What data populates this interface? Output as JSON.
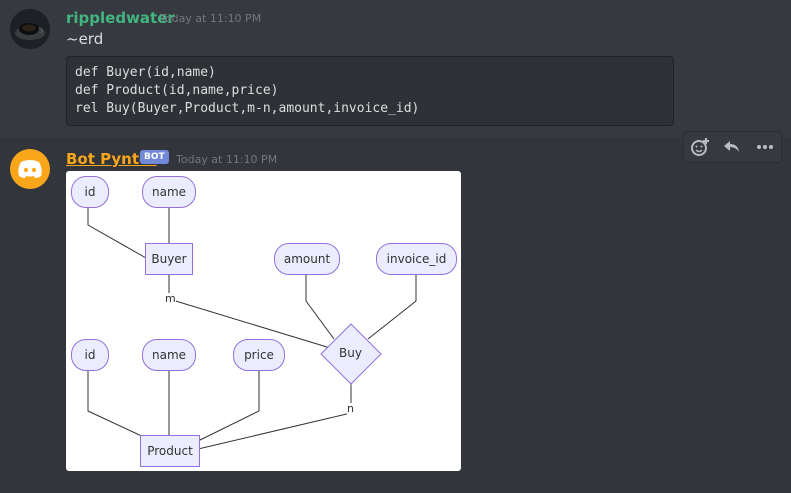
{
  "messages": [
    {
      "username": "rippledwater",
      "timestamp": "Today at 11:10 PM",
      "text": "~erd",
      "code": [
        "def Buyer(id,name)",
        "def Product(id,name,price)",
        "rel Buy(Buyer,Product,m-n,amount,invoice_id)"
      ],
      "avatar_icon": "coffee-cup-avatar"
    },
    {
      "username": "Bot Pynter",
      "badge": "BOT",
      "timestamp": "Today at 11:10 PM",
      "avatar_icon": "discord-logo-icon"
    }
  ],
  "toolbar": {
    "icons": [
      "add-reaction-icon",
      "reply-icon",
      "more-icon"
    ]
  },
  "erd": {
    "buyer_attrs": [
      "id",
      "name"
    ],
    "buyer": "Buyer",
    "buy_attrs": [
      "amount",
      "invoice_id"
    ],
    "relationship": "Buy",
    "product_attrs": [
      "id",
      "name",
      "price"
    ],
    "product": "Product",
    "card_m": "m",
    "card_n": "n"
  },
  "colors": {
    "background": "#36393f",
    "user1": "#43b581",
    "user2": "#faa61a",
    "badge": "#7289da",
    "node_fill": "#ececff",
    "node_stroke": "#9370db"
  }
}
